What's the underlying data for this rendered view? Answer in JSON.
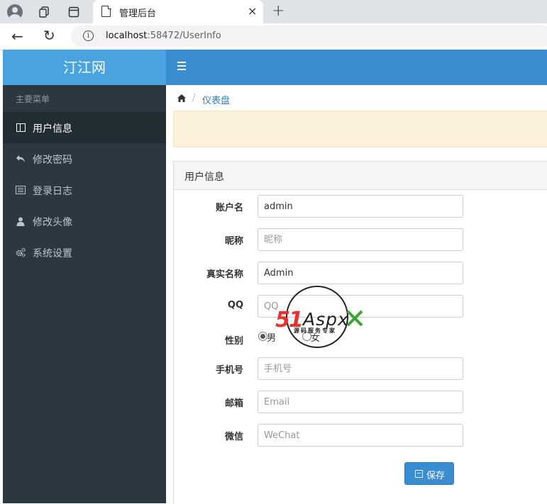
{
  "browser": {
    "tab_title": "管理后台",
    "tab_close": "×",
    "new_tab": "+",
    "url_host": "localhost",
    "url_rest": ":58472/UserInfo"
  },
  "app": {
    "brand": "汀江网",
    "menu_header": "主要菜单",
    "menu": [
      {
        "label": "用户信息",
        "icon": "columns-icon",
        "active": true
      },
      {
        "label": "修改密码",
        "icon": "reply-icon",
        "active": false
      },
      {
        "label": "登录日志",
        "icon": "list-icon",
        "active": false
      },
      {
        "label": "修改头像",
        "icon": "user-icon",
        "active": false
      },
      {
        "label": "系统设置",
        "icon": "cogs-icon",
        "active": false
      }
    ]
  },
  "breadcrumb": {
    "separator": "/",
    "current": "仪表盘"
  },
  "panel": {
    "title": "用户信息"
  },
  "form": {
    "account": {
      "label": "账户名",
      "value": "admin",
      "placeholder": ""
    },
    "nickname": {
      "label": "昵称",
      "value": "",
      "placeholder": "昵称"
    },
    "realname": {
      "label": "真实名称",
      "value": "Admin",
      "placeholder": ""
    },
    "qq": {
      "label": "QQ",
      "value": "",
      "placeholder": "QQ"
    },
    "gender": {
      "label": "性别",
      "options": [
        "男",
        "女"
      ],
      "selected": "男"
    },
    "phone": {
      "label": "手机号",
      "value": "",
      "placeholder": "手机号"
    },
    "email": {
      "label": "邮箱",
      "value": "",
      "placeholder": "Email"
    },
    "wechat": {
      "label": "微信",
      "value": "",
      "placeholder": "WeChat"
    },
    "save_label": "保存"
  },
  "watermark": {
    "brand": "51Aspx",
    "tagline": "源码服务专家"
  },
  "colors": {
    "brand_bg": "#4aa3df",
    "topbar_bg": "#3c8dcf",
    "sidebar_bg": "#2c3740",
    "sidebar_active_bg": "#222c33",
    "alert_bg": "#fcf2dc",
    "link": "#2e7fbd"
  }
}
